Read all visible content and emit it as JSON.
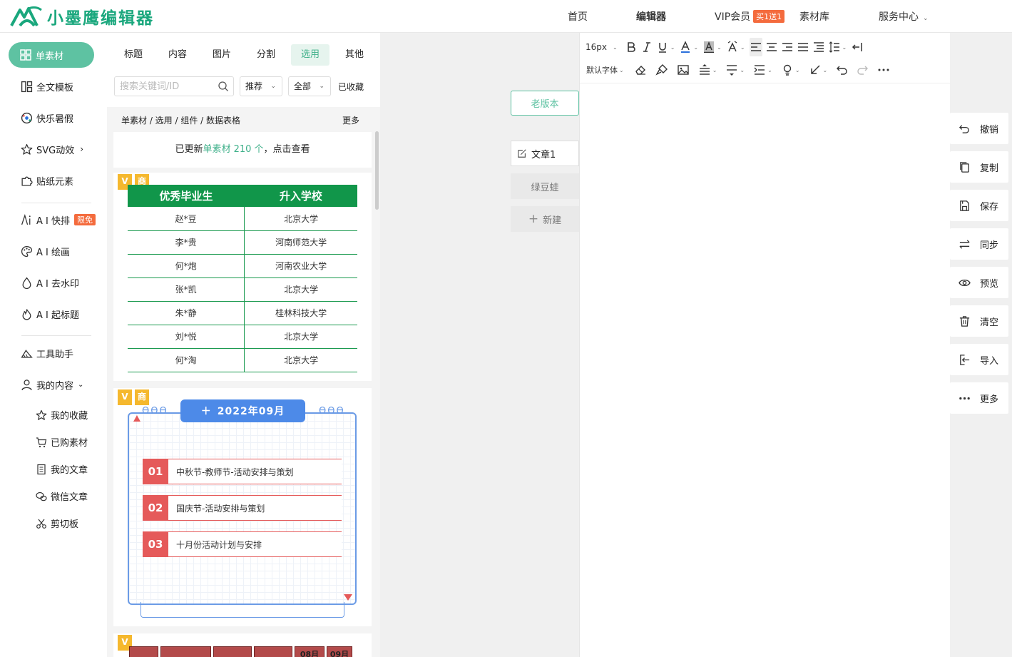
{
  "header": {
    "logo_text": "小墨鹰编辑器",
    "nav": {
      "home": "首页",
      "editor": "编辑器",
      "vip": "VIP会员",
      "vip_badge": "买1送1",
      "library": "素材库",
      "service": "服务中心"
    }
  },
  "sidebar": {
    "active_label": "单素材",
    "items": [
      {
        "label": "全文模板",
        "icon": "template-icon"
      },
      {
        "label": "快乐暑假",
        "icon": "ball-icon"
      },
      {
        "label": "SVG动效",
        "icon": "star-icon"
      },
      {
        "label": "贴纸元素",
        "icon": "puzzle-icon"
      },
      {
        "label": "A I 快排",
        "icon": "ai-icon",
        "badge": "限免"
      },
      {
        "label": "A I 绘画",
        "icon": "palette-icon"
      },
      {
        "label": "A I 去水印",
        "icon": "drop-icon"
      },
      {
        "label": "A I 起标题",
        "icon": "fire-icon"
      },
      {
        "label": "工具助手",
        "icon": "tool-icon"
      },
      {
        "label": "我的内容",
        "icon": "user-icon"
      }
    ],
    "sub_items": [
      {
        "label": "我的收藏",
        "icon": "star-icon"
      },
      {
        "label": "已购素材",
        "icon": "cart-icon"
      },
      {
        "label": "我的文章",
        "icon": "document-icon"
      },
      {
        "label": "微信文章",
        "icon": "wechat-icon"
      },
      {
        "label": "剪切板",
        "icon": "scissors-icon"
      }
    ]
  },
  "panel": {
    "tabs": [
      "标题",
      "内容",
      "图片",
      "分割",
      "选用",
      "其他"
    ],
    "active_tab": "选用",
    "search_placeholder": "搜索关键词/ID",
    "filter_sort": "推荐",
    "filter_scope": "全部",
    "collected": "已收藏",
    "breadcrumb": "单素材 / 选用 / 组件 / 数据表格",
    "more": "更多",
    "update_prefix": "已更新",
    "update_highlight": "单素材 210 个",
    "update_suffix": "，点击查看",
    "tag_v": "V",
    "tag_s": "商"
  },
  "grad_table": {
    "headers": [
      "优秀毕业生",
      "升入学校"
    ],
    "rows": [
      [
        "赵*豆",
        "北京大学"
      ],
      [
        "李*贵",
        "河南师范大学"
      ],
      [
        "何*炮",
        "河南农业大学"
      ],
      [
        "张*凯",
        "北京大学"
      ],
      [
        "朱*静",
        "桂林科技大学"
      ],
      [
        "刘*悦",
        "北京大学"
      ],
      [
        "何*淘",
        "北京大学"
      ]
    ]
  },
  "calendar_card": {
    "plus": "＋",
    "month": "2022年09月",
    "items": [
      {
        "num": "01",
        "text": "中秋节-教师节-活动安排与策划"
      },
      {
        "num": "02",
        "text": "国庆节-活动安排与策划"
      },
      {
        "num": "03",
        "text": "十月份活动计划与安排"
      }
    ]
  },
  "card3": {
    "cells": [
      "",
      "",
      "",
      "",
      "08月31",
      "09月"
    ]
  },
  "middle": {
    "old_version": "老版本",
    "doc_tabs": [
      "文章1",
      "绿豆蛙"
    ],
    "new_doc": "新建"
  },
  "editor": {
    "font_size": "16px",
    "font_family": "默认字体"
  },
  "right_actions": [
    {
      "label": "撤销",
      "icon": "undo-icon"
    },
    {
      "label": "复制",
      "icon": "copy-icon"
    },
    {
      "label": "保存",
      "icon": "save-icon"
    },
    {
      "label": "同步",
      "icon": "sync-icon"
    },
    {
      "label": "预览",
      "icon": "eye-icon"
    },
    {
      "label": "清空",
      "icon": "trash-icon"
    },
    {
      "label": "导入",
      "icon": "import-icon"
    },
    {
      "label": "更多",
      "icon": "more-icon"
    }
  ],
  "colors": {
    "brand": "#1aa77d",
    "accent": "#5ec2a2",
    "table_green": "#11964a",
    "calendar_blue": "#4d8ae8",
    "calendar_red": "#e55a5a",
    "badge_orange": "#f46b3d"
  }
}
